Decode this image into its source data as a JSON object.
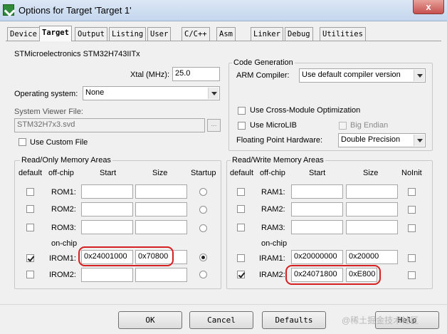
{
  "window": {
    "title": "Options for Target 'Target 1'",
    "close_glyph": "x"
  },
  "tabs": [
    "Device",
    "Target",
    "Output",
    "Listing",
    "User",
    "C/C++",
    "Asm",
    "Linker",
    "Debug",
    "Utilities"
  ],
  "device": {
    "name": "STMicroelectronics STM32H743IITx"
  },
  "xtal": {
    "label": "Xtal (MHz):",
    "value": "25.0"
  },
  "os": {
    "label": "Operating system:",
    "value": "None"
  },
  "svd": {
    "label": "System Viewer File:",
    "value": "STM32H7x3.svd",
    "browse": "...",
    "custom_label": "Use Custom File"
  },
  "codegen": {
    "title": "Code Generation",
    "compiler_label": "ARM Compiler:",
    "compiler_value": "Use default compiler version",
    "cross_module": "Use Cross-Module Optimization",
    "microlib": "Use MicroLIB",
    "big_endian": "Big Endian",
    "fpu_label": "Floating Point Hardware:",
    "fpu_value": "Double Precision"
  },
  "rom": {
    "title": "Read/Only Memory Areas",
    "headers": {
      "default": "default",
      "offchip": "off-chip",
      "start": "Start",
      "size": "Size",
      "last": "Startup"
    },
    "onchip_label": "on-chip",
    "rows": [
      {
        "label": "ROM1:",
        "start": "",
        "size": "",
        "default": false,
        "selected": false
      },
      {
        "label": "ROM2:",
        "start": "",
        "size": "",
        "default": false,
        "selected": false
      },
      {
        "label": "ROM3:",
        "start": "",
        "size": "",
        "default": false,
        "selected": false
      },
      {
        "label": "IROM1:",
        "start": "0x24001000",
        "size": "0x70800",
        "default": true,
        "selected": true
      },
      {
        "label": "IROM2:",
        "start": "",
        "size": "",
        "default": false,
        "selected": false
      }
    ]
  },
  "ram": {
    "title": "Read/Write Memory Areas",
    "headers": {
      "default": "default",
      "offchip": "off-chip",
      "start": "Start",
      "size": "Size",
      "last": "NoInit"
    },
    "onchip_label": "on-chip",
    "rows": [
      {
        "label": "RAM1:",
        "start": "",
        "size": "",
        "default": false,
        "noinit": false
      },
      {
        "label": "RAM2:",
        "start": "",
        "size": "",
        "default": false,
        "noinit": false
      },
      {
        "label": "RAM3:",
        "start": "",
        "size": "",
        "default": false,
        "noinit": false
      },
      {
        "label": "IRAM1:",
        "start": "0x20000000",
        "size": "0x20000",
        "default": false,
        "noinit": false
      },
      {
        "label": "IRAM2:",
        "start": "0x24071800",
        "size": "0xE800",
        "default": true,
        "noinit": false
      }
    ]
  },
  "buttons": {
    "ok": "OK",
    "cancel": "Cancel",
    "defaults": "Defaults",
    "help": "Help"
  },
  "watermark": "@稀土掘金技术社区"
}
